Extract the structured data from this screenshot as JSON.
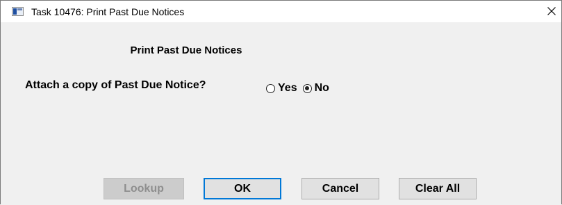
{
  "window": {
    "title": "Task 10476: Print Past Due Notices",
    "icon": "app-window-icon",
    "close_icon": "close-icon"
  },
  "main": {
    "heading": "Print Past Due Notices",
    "question": "Attach a copy of Past Due Notice?",
    "options": [
      {
        "label": "Yes",
        "selected": false
      },
      {
        "label": "No",
        "selected": true
      }
    ]
  },
  "buttons": {
    "lookup": "Lookup",
    "ok": "OK",
    "cancel": "Cancel",
    "clear_all": "Clear All"
  },
  "colors": {
    "focus_border": "#0078d7",
    "dialog_bg": "#f0f0f0"
  }
}
